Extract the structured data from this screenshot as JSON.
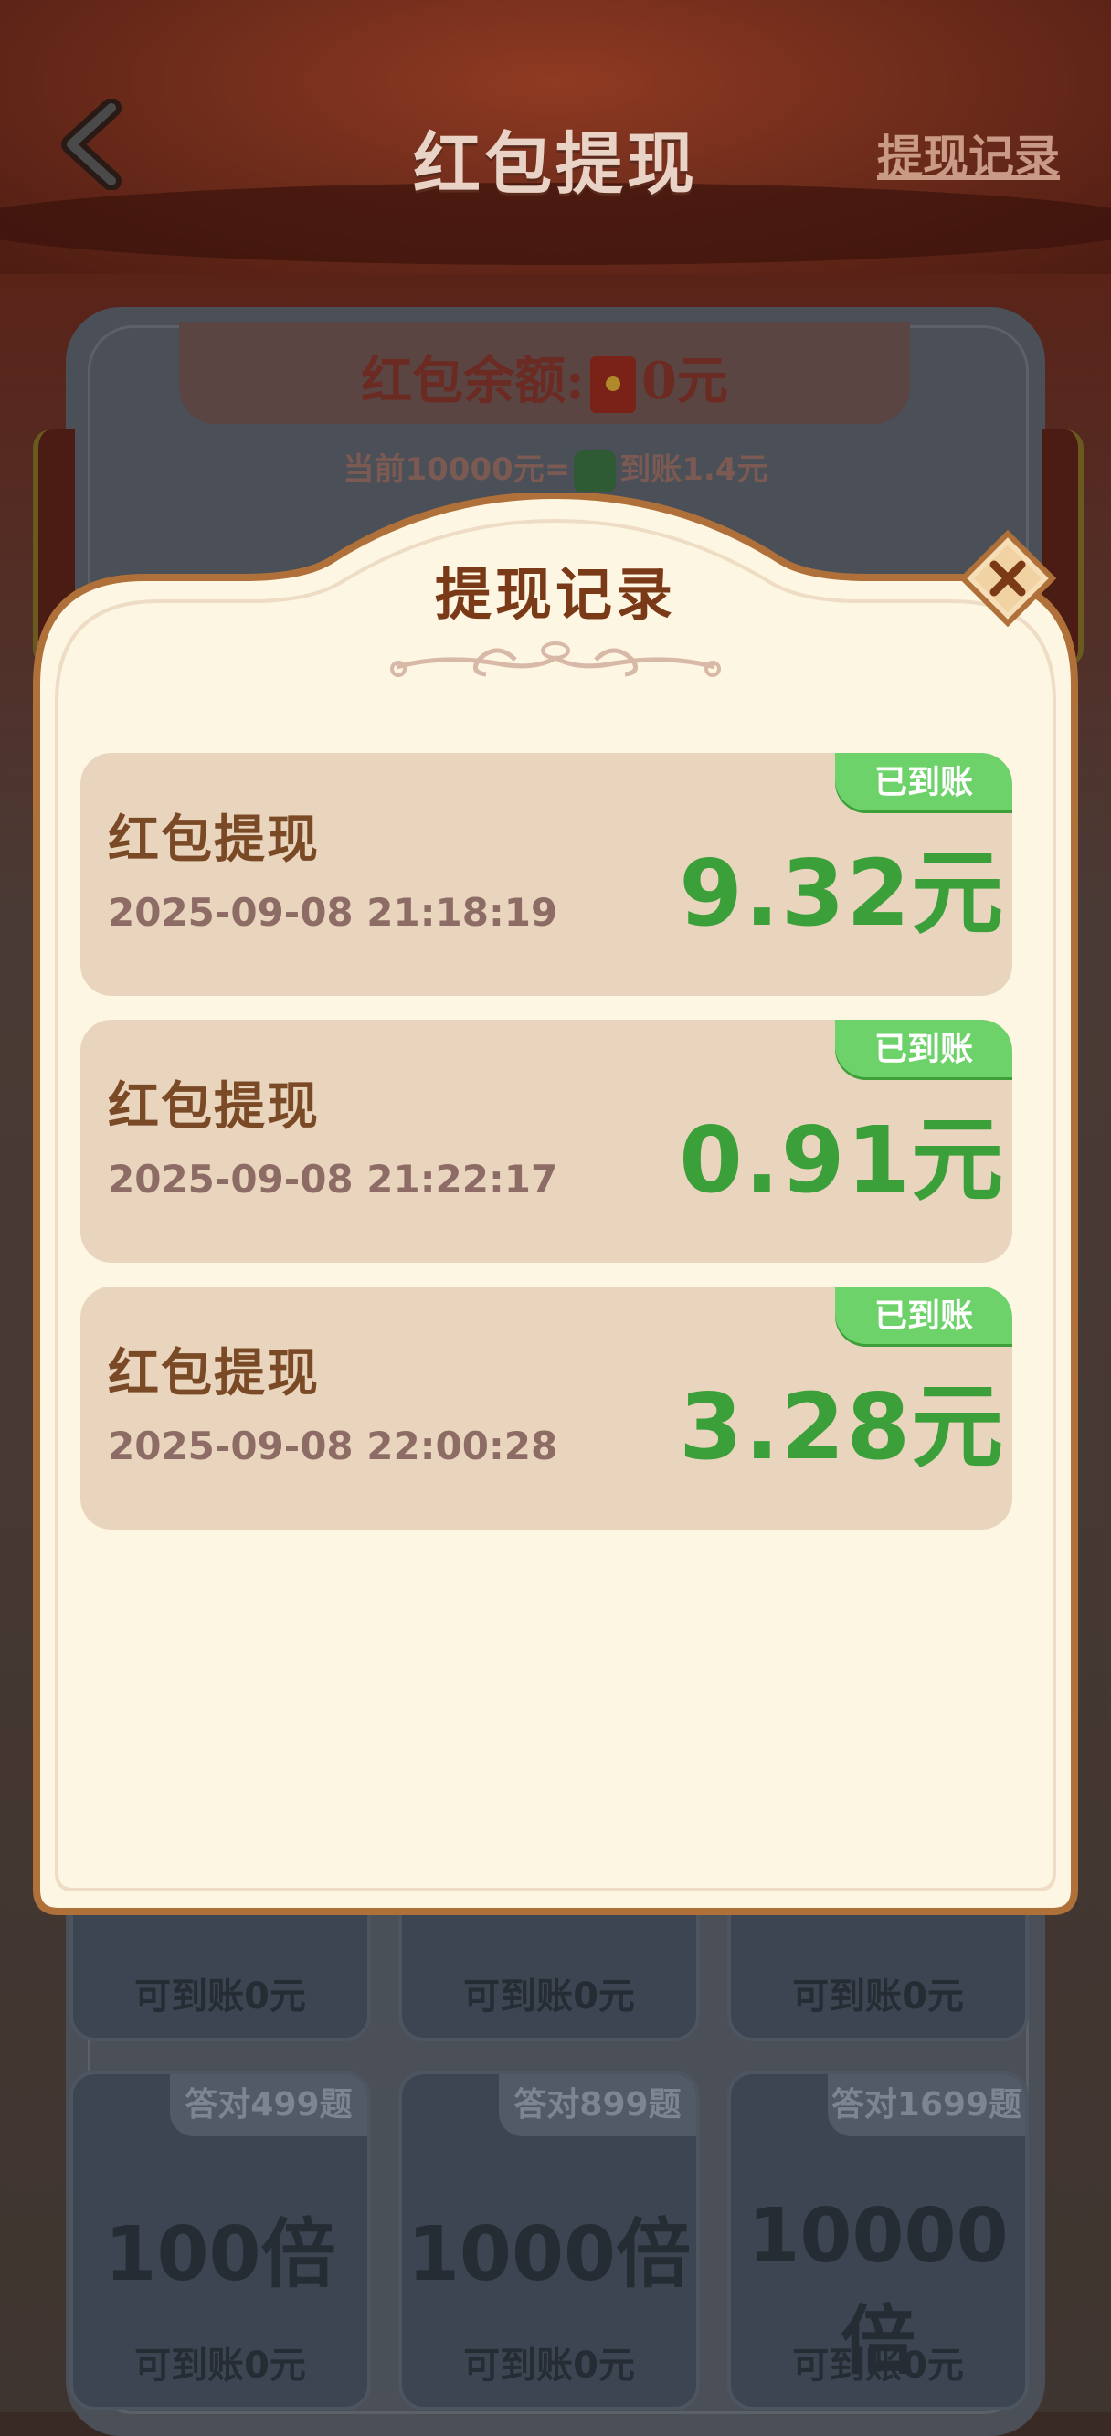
{
  "header": {
    "title": "红包提现",
    "record_link": "提现记录"
  },
  "balance": {
    "label": "红包余额:",
    "amount": "0元",
    "rate_prefix": "当前10000元=",
    "rate_suffix": "到账1.4元"
  },
  "grid": {
    "row1_avail": [
      "可到账0元",
      "可到账0元",
      "可到账0元"
    ],
    "row2": [
      {
        "badge": "答对499题",
        "multiplier": "100倍",
        "avail": "可到账0元"
      },
      {
        "badge": "答对899题",
        "multiplier": "1000倍",
        "avail": "可到账0元"
      },
      {
        "badge": "答对1699题",
        "multiplier": "10000倍",
        "avail": "可到账0元"
      }
    ]
  },
  "modal": {
    "title": "提现记录",
    "records": [
      {
        "title": "红包提现",
        "time": "2025-09-08 21:18:19",
        "amount": "9.32元",
        "status": "已到账"
      },
      {
        "title": "红包提现",
        "time": "2025-09-08 21:22:17",
        "amount": "0.91元",
        "status": "已到账"
      },
      {
        "title": "红包提现",
        "time": "2025-09-08 22:00:28",
        "amount": "3.28元",
        "status": "已到账"
      }
    ]
  },
  "colors": {
    "accent_green": "#3ca03a",
    "status_green": "#6dd26a",
    "modal_bg": "#fdf6e3",
    "modal_border": "#b0703a",
    "title_brown": "#7a3a18"
  },
  "icons": [
    "back-arrow-icon",
    "red-packet-icon",
    "wechat-icon",
    "close-icon",
    "ornament-divider"
  ]
}
